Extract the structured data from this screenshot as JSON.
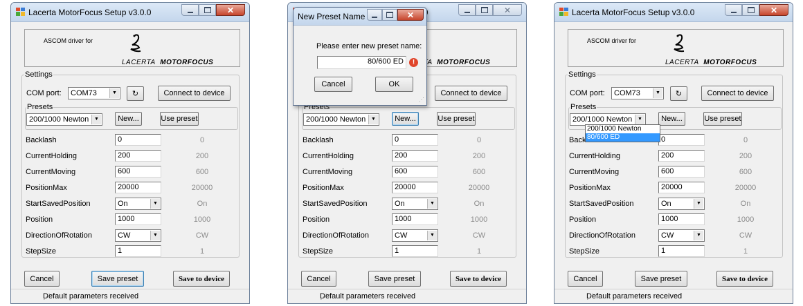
{
  "window_title": "Lacerta MotorFocus Setup v3.0.0",
  "ascom_text": "ASCOM driver for",
  "brand": {
    "left": "LACERTA",
    "right": "MOTORFOCUS"
  },
  "settings_label": "Settings",
  "com_port_label": "COM port:",
  "com_port_value": "COM73",
  "refresh_glyph": "↻",
  "connect_label": "Connect to device",
  "presets_label": "Presets",
  "preset_value": "200/1000 Newton",
  "new_label": "New...",
  "use_preset_label": "Use preset",
  "params": [
    {
      "name": "Backlash",
      "value": "0",
      "device": "0"
    },
    {
      "name": "CurrentHolding",
      "value": "200",
      "device": "200"
    },
    {
      "name": "CurrentMoving",
      "value": "600",
      "device": "600"
    },
    {
      "name": "PositionMax",
      "value": "20000",
      "device": "20000"
    },
    {
      "name": "StartSavedPosition",
      "value": "On",
      "device": "On"
    },
    {
      "name": "Position",
      "value": "1000",
      "device": "1000"
    },
    {
      "name": "DirectionOfRotation",
      "value": "CW",
      "device": "CW"
    },
    {
      "name": "StepSize",
      "value": "1",
      "device": "1"
    }
  ],
  "cancel_label": "Cancel",
  "save_preset_label": "Save preset",
  "save_device_label": "Save to device",
  "status_text": "Default parameters received",
  "dialog": {
    "title": "New Preset Name",
    "prompt": "Please enter new preset name:",
    "input_value": "80/600 ED",
    "cancel_label": "Cancel",
    "ok_label": "OK",
    "error_glyph": "!"
  },
  "dropdown_options": [
    "200/1000 Newton",
    "80/600 ED"
  ],
  "colors": {
    "accent": "#3399ff",
    "error": "#e0452b",
    "close": "#c7452c"
  }
}
